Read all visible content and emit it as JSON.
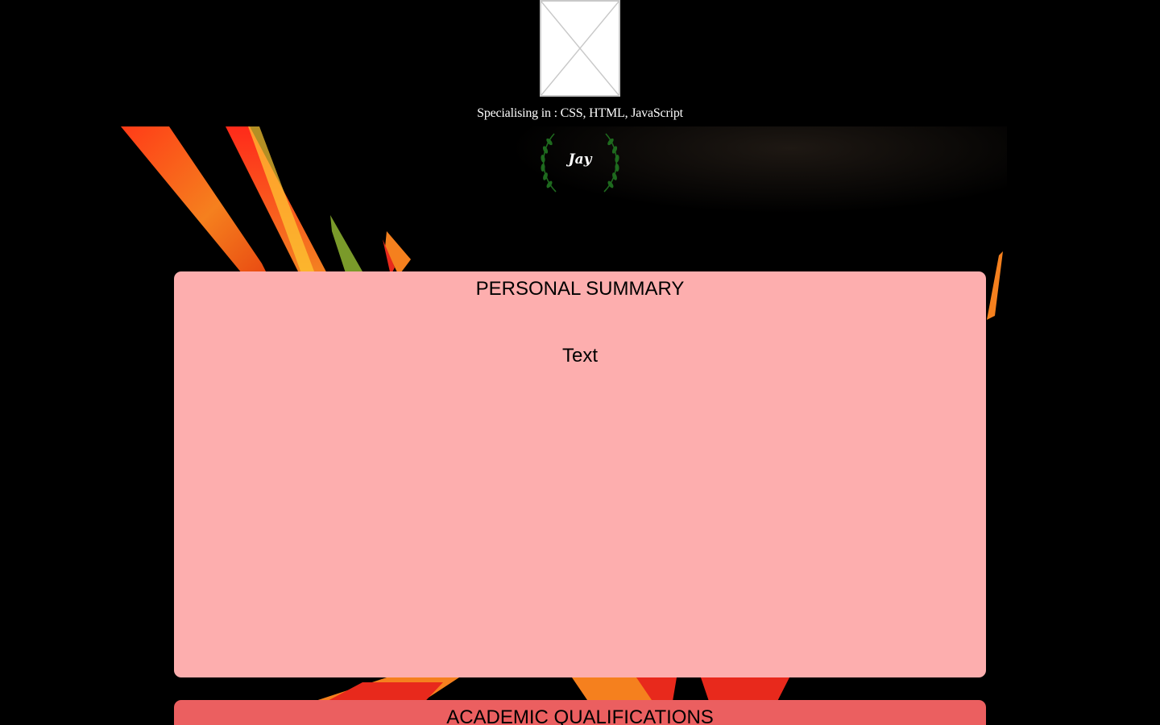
{
  "header": {
    "profile_image_alt": "",
    "specialising_text": "Specialising in : CSS, HTML, JavaScript"
  },
  "logo": {
    "name": "Jay",
    "laurel_color": "#1e6a1e"
  },
  "sections": {
    "personal_summary": {
      "title": "PERSONAL SUMMARY",
      "body": "Text",
      "background": "#fdaeae"
    },
    "academic_qualifications": {
      "title": "ACADEMIC QUALIFICATIONS",
      "background": "#eb5f60"
    }
  },
  "colors": {
    "page_background": "#000000",
    "flower_red": "#e8291c",
    "flower_orange": "#f5801e"
  }
}
